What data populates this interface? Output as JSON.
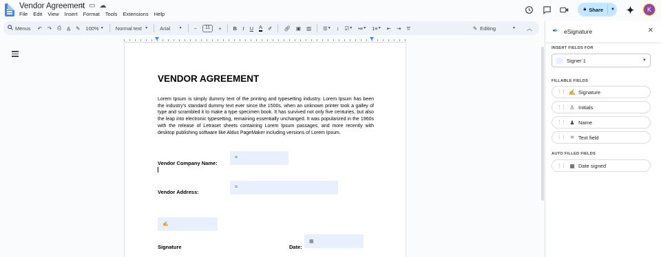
{
  "app": {
    "doc_title": "Vendor Agreement",
    "menu": [
      "File",
      "Edit",
      "View",
      "Insert",
      "Format",
      "Tools",
      "Extensions",
      "Help"
    ],
    "share_label": "Share",
    "avatar_initial": "K"
  },
  "toolbar": {
    "menus_label": "Menus",
    "zoom": "100%",
    "style": "Normal text",
    "font": "Arial",
    "font_size": "11",
    "editing_label": "Editing"
  },
  "document": {
    "heading": "VENDOR AGREEMENT",
    "paragraph": "Lorem Ipsum is simply dummy text of the printing and typesetting industry. Lorem Ipsum has been the industry's standard dummy text ever since the 1500s, when an unknown printer took a galley of type and scrambled it to make a type specimen book. It has survived not only five centuries, but also the leap into electronic typesetting, remaining essentially unchanged. It was popularized in the 1960s with the release of Letraset sheets containing Lorem Ipsum passages, and more recently with desktop publishing software like Aldus PageMaker including versions of Lorem Ipsum.",
    "labels": {
      "vendor_company": "Vendor Company Name:",
      "vendor_address": "Vendor Address:",
      "signature": "Signature",
      "date": "Date:"
    }
  },
  "panel": {
    "title": "eSignature",
    "insert_fields_for": "INSERT FIELDS FOR",
    "signer": "Signer 1",
    "fillable_fields_label": "FILLABLE FIELDS",
    "fillable_fields": [
      "Signature",
      "Initials",
      "Name",
      "Text field"
    ],
    "auto_filled_label": "AUTO FILLED FIELDS",
    "auto_filled_fields": [
      "Date signed"
    ]
  },
  "colors": {
    "accent": "#1a73e8",
    "share_bg": "#c2e7ff",
    "field_bg": "#e8f0fe",
    "toolbar_bg": "#edf2fa"
  }
}
